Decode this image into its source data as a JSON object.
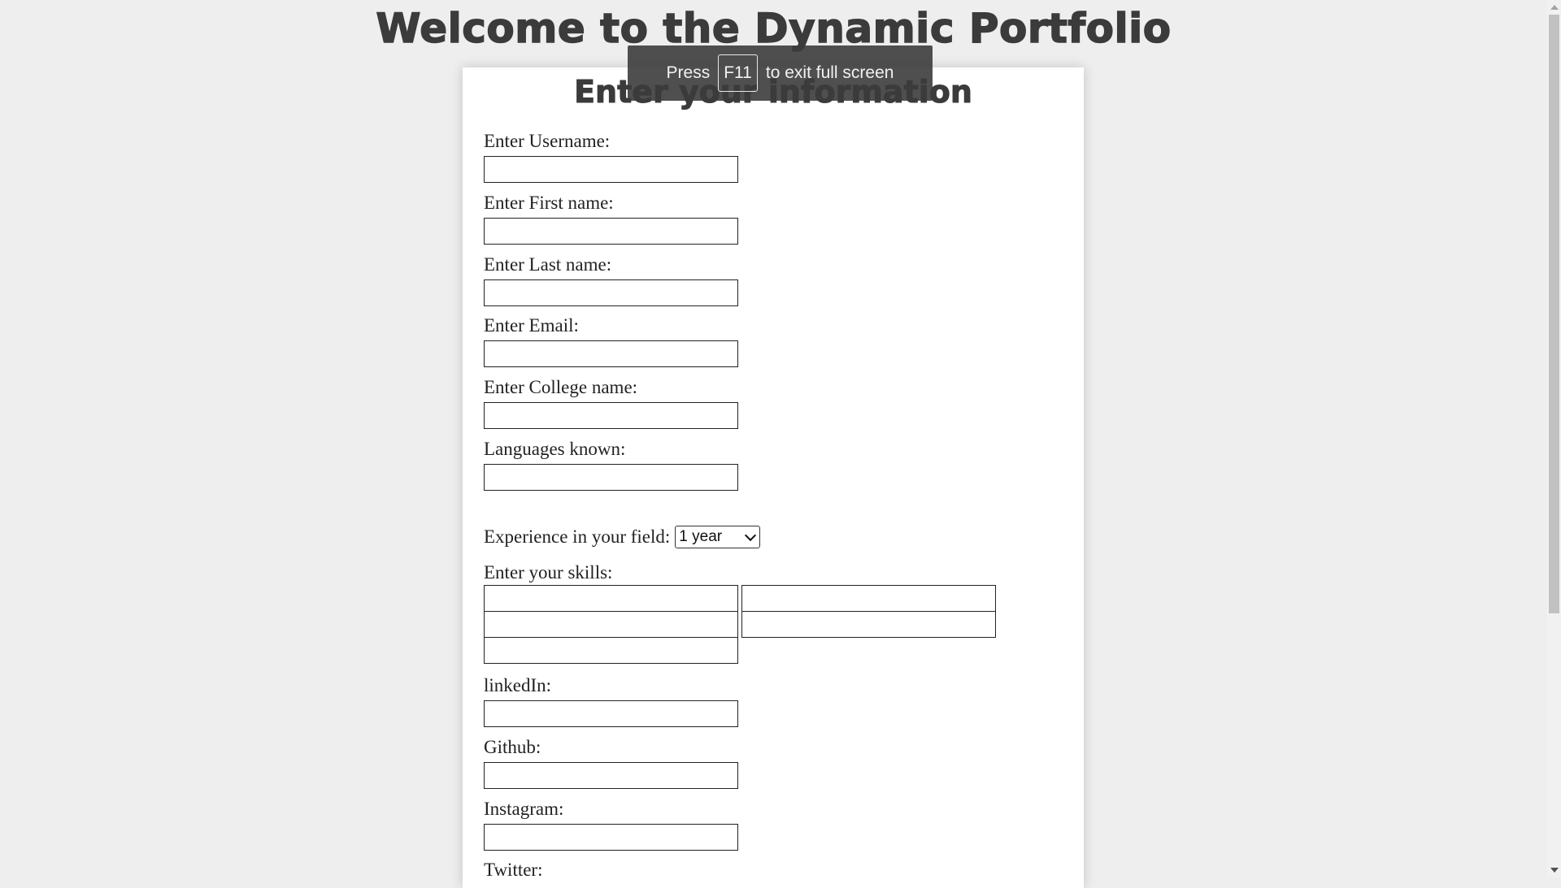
{
  "page": {
    "title": "Welcome to the Dynamic Portfolio"
  },
  "form": {
    "title": "Enter your information",
    "fields": [
      {
        "label": "Enter Username:",
        "value": ""
      },
      {
        "label": "Enter First name:",
        "value": ""
      },
      {
        "label": "Enter Last name:",
        "value": ""
      },
      {
        "label": "Enter Email:",
        "value": ""
      },
      {
        "label": "Enter College name:",
        "value": ""
      },
      {
        "label": "Languages known:",
        "value": ""
      }
    ],
    "experience": {
      "label": "Experience in your field:",
      "selected": "1 year"
    },
    "skills": {
      "label": "Enter your skills:",
      "values": [
        "",
        "",
        "",
        "",
        ""
      ]
    },
    "social": [
      {
        "label": "linkedIn:",
        "value": ""
      },
      {
        "label": "Github:",
        "value": ""
      },
      {
        "label": "Instagram:",
        "value": ""
      },
      {
        "label": "Twitter:",
        "value": ""
      }
    ]
  },
  "fullscreen_toast": {
    "prefix": "Press",
    "key": "F11",
    "suffix": "to exit full screen"
  }
}
